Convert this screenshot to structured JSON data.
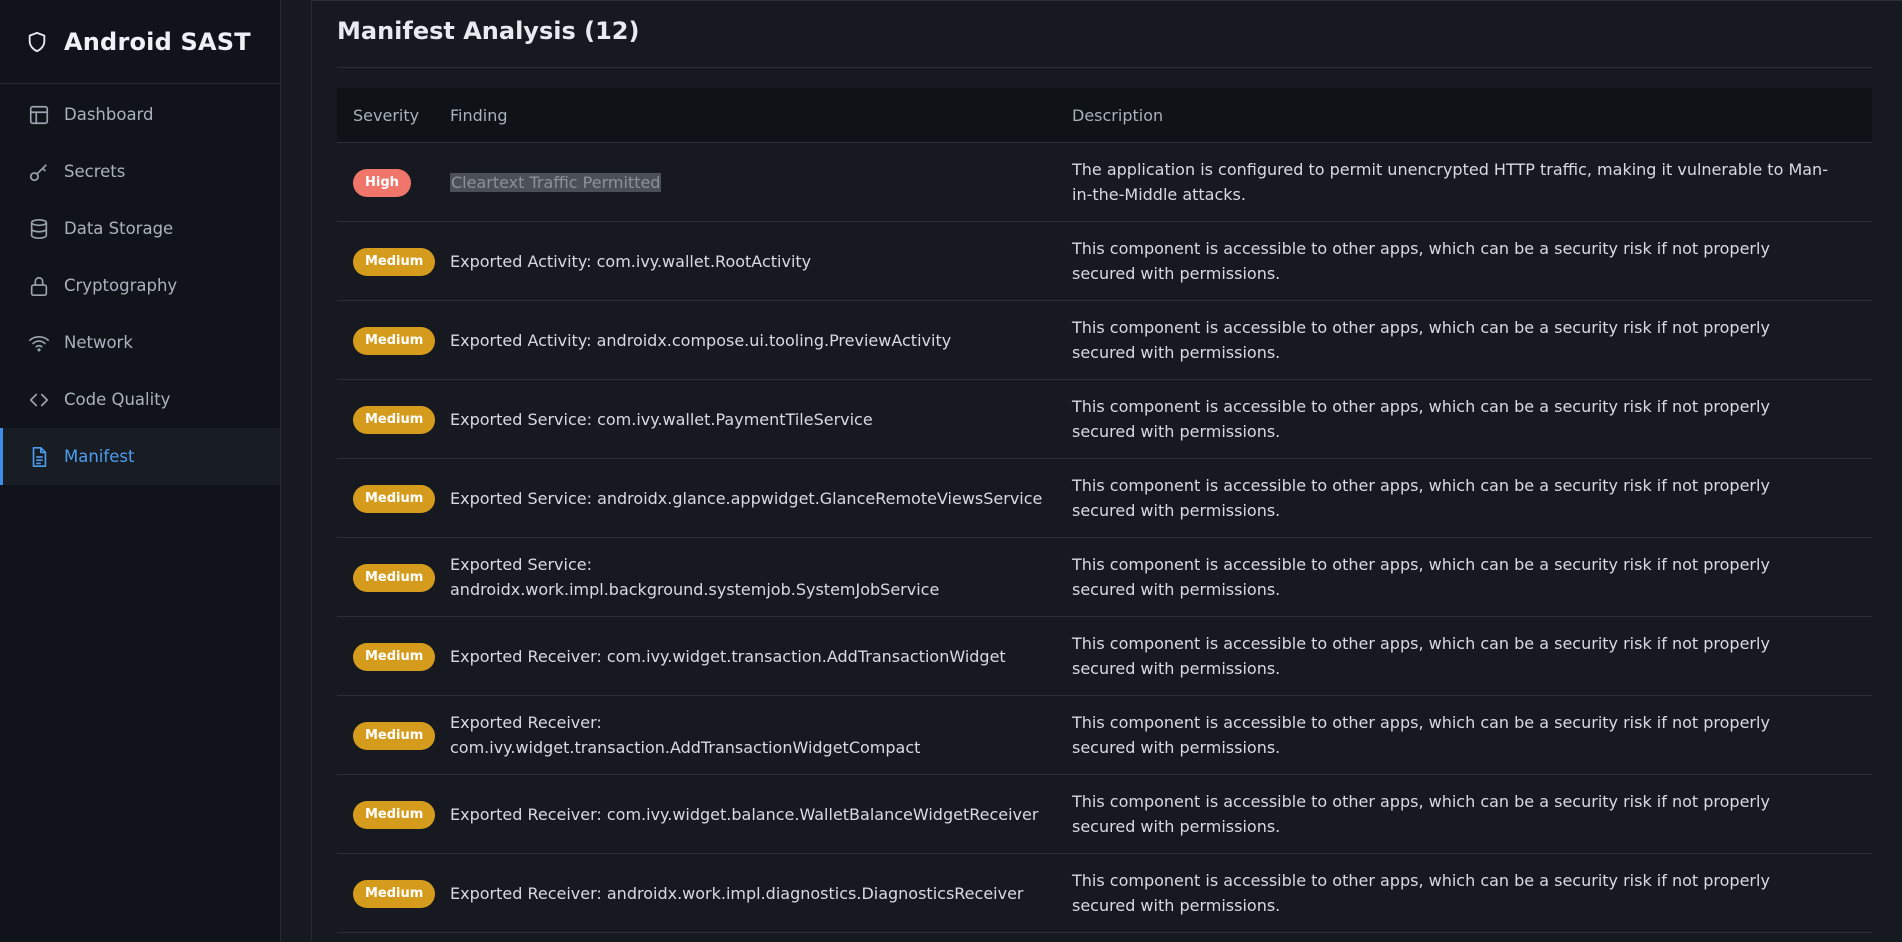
{
  "app": {
    "title": "Android SAST"
  },
  "sidebar": {
    "items": [
      {
        "label": "Dashboard",
        "icon": "dashboard-icon"
      },
      {
        "label": "Secrets",
        "icon": "key-icon"
      },
      {
        "label": "Data Storage",
        "icon": "database-icon"
      },
      {
        "label": "Cryptography",
        "icon": "lock-icon"
      },
      {
        "label": "Network",
        "icon": "wifi-icon"
      },
      {
        "label": "Code Quality",
        "icon": "code-icon"
      },
      {
        "label": "Manifest",
        "icon": "file-icon",
        "active": true
      }
    ]
  },
  "main": {
    "title": "Manifest Analysis (12)",
    "columns": {
      "severity": "Severity",
      "finding": "Finding",
      "description": "Description"
    },
    "rows": [
      {
        "severity": "High",
        "finding": "Cleartext Traffic Permitted",
        "description": "The application is configured to permit unencrypted HTTP traffic, making it vulnerable to Man-in-the-Middle attacks."
      },
      {
        "severity": "Medium",
        "finding": "Exported Activity: com.ivy.wallet.RootActivity",
        "description": "This component is accessible to other apps, which can be a security risk if not properly secured with permissions."
      },
      {
        "severity": "Medium",
        "finding": "Exported Activity: androidx.compose.ui.tooling.PreviewActivity",
        "description": "This component is accessible to other apps, which can be a security risk if not properly secured with permissions."
      },
      {
        "severity": "Medium",
        "finding": "Exported Service: com.ivy.wallet.PaymentTileService",
        "description": "This component is accessible to other apps, which can be a security risk if not properly secured with permissions."
      },
      {
        "severity": "Medium",
        "finding": "Exported Service: androidx.glance.appwidget.GlanceRemoteViewsService",
        "description": "This component is accessible to other apps, which can be a security risk if not properly secured with permissions."
      },
      {
        "severity": "Medium",
        "finding": "Exported Service: androidx.work.impl.background.systemjob.SystemJobService",
        "description": "This component is accessible to other apps, which can be a security risk if not properly secured with permissions."
      },
      {
        "severity": "Medium",
        "finding": "Exported Receiver: com.ivy.widget.transaction.AddTransactionWidget",
        "description": "This component is accessible to other apps, which can be a security risk if not properly secured with permissions."
      },
      {
        "severity": "Medium",
        "finding": "Exported Receiver: com.ivy.widget.transaction.AddTransactionWidgetCompact",
        "description": "This component is accessible to other apps, which can be a security risk if not properly secured with permissions."
      },
      {
        "severity": "Medium",
        "finding": "Exported Receiver: com.ivy.widget.balance.WalletBalanceWidgetReceiver",
        "description": "This component is accessible to other apps, which can be a security risk if not properly secured with permissions."
      },
      {
        "severity": "Medium",
        "finding": "Exported Receiver: androidx.work.impl.diagnostics.DiagnosticsReceiver",
        "description": "This component is accessible to other apps, which can be a security risk if not properly secured with permissions."
      }
    ]
  },
  "colors": {
    "accent": "#4d9cf0",
    "high": "#f0756a",
    "medium": "#d59b1c"
  }
}
